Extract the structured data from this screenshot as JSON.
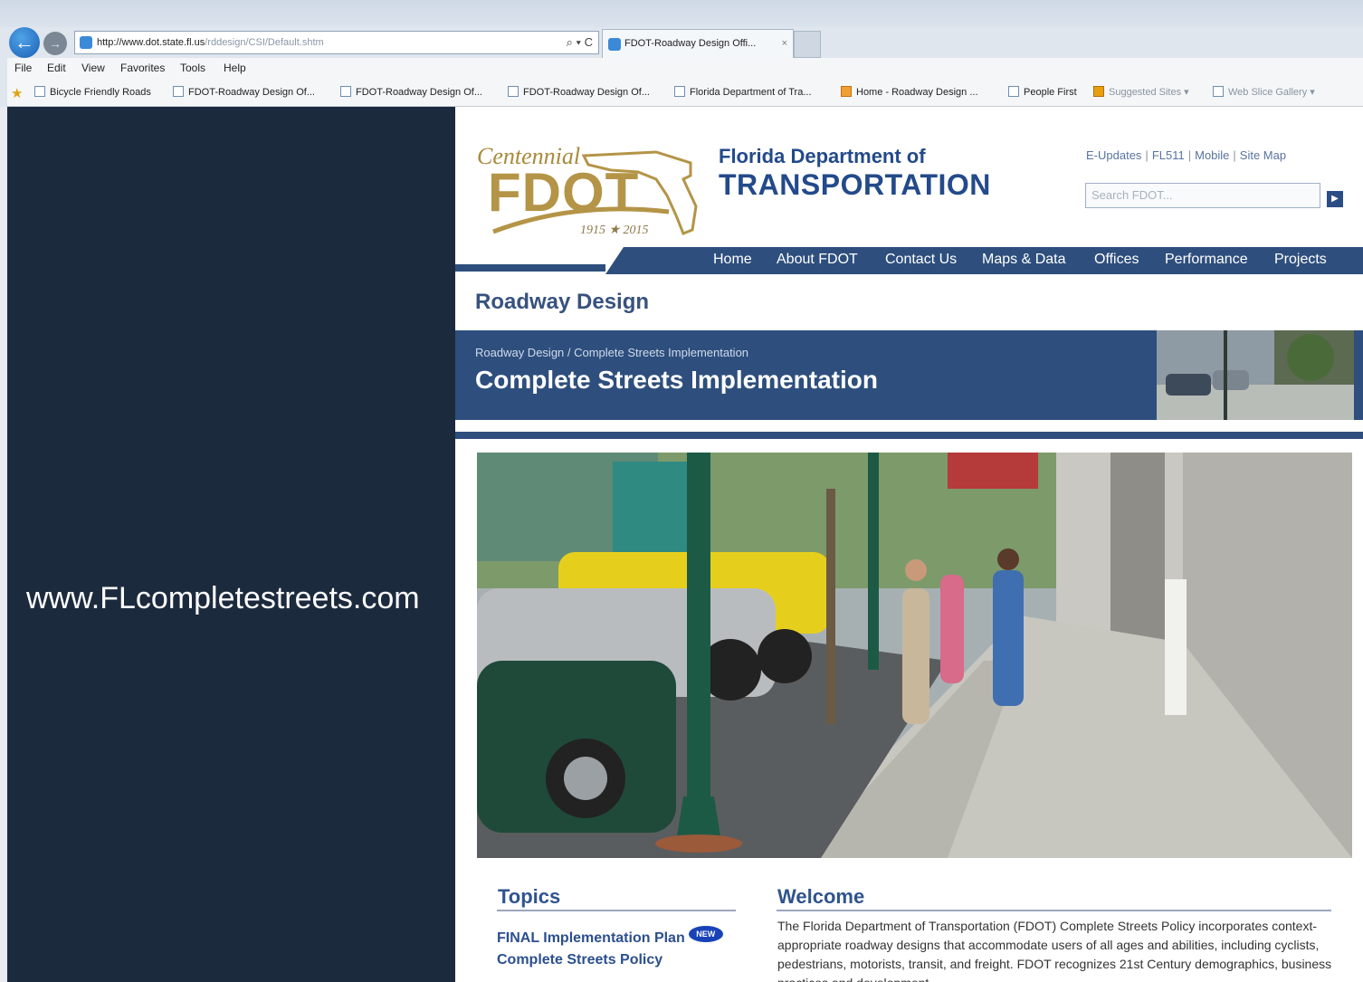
{
  "browser": {
    "url_strong": "http://www.dot.state.fl.us",
    "url_rest": "/rddesign/CSI/Default.shtm",
    "address_tools": "⌕ ▾ C",
    "tab_title": "FDOT-Roadway Design Offi...",
    "tab_close": "×",
    "menu": [
      "File",
      "Edit",
      "View",
      "Favorites",
      "Tools",
      "Help"
    ],
    "favorites": [
      "Bicycle Friendly Roads",
      "FDOT-Roadway Design Of...",
      "FDOT-Roadway Design Of...",
      "FDOT-Roadway Design Of...",
      "Florida Department of Tra...",
      "Home - Roadway Design ...",
      "People First",
      "Suggested Sites ▾",
      "Web Slice Gallery ▾"
    ]
  },
  "slide": {
    "url_text": "www.FLcompletestreets.com"
  },
  "fdot": {
    "logo_centennial": "Centennial",
    "logo_fdot": "FDOT",
    "logo_years": "1915 ★ 2015",
    "dept_line1": "Florida Department of",
    "dept_line2": "TRANSPORTATION",
    "util_links": [
      "E-Updates",
      "FL511",
      "Mobile",
      "Site Map"
    ],
    "search_placeholder": "Search FDOT...",
    "search_button": "▶",
    "nav": [
      "Home",
      "About FDOT",
      "Contact Us",
      "Maps & Data",
      "Offices",
      "Performance",
      "Projects"
    ],
    "section_title": "Roadway Design",
    "breadcrumb": "Roadway Design / Complete Streets Implementation",
    "banner_title": "Complete Streets Implementation",
    "topics_title": "Topics",
    "topics": [
      "FINAL Implementation Plan",
      "Complete Streets Policy"
    ],
    "new_badge": "NEW",
    "welcome_title": "Welcome",
    "welcome_text": "The Florida Department of Transportation (FDOT) Complete Streets Policy incorporates context-appropriate roadway designs that accommodate users of all ages and abilities, including cyclists, pedestrians, motorists, transit, and freight. FDOT recognizes 21st Century demographics, business practices and development"
  },
  "colors": {
    "panel": "#1c2a3e",
    "fdot_blue": "#2e4f7d",
    "fdot_gold": "#b49447",
    "link_blue": "#2b4f8f"
  }
}
